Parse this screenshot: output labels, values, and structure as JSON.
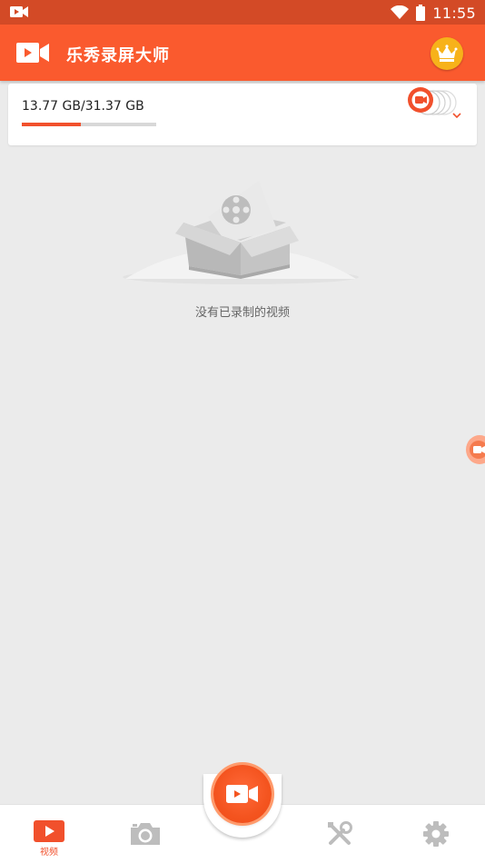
{
  "status_bar": {
    "time": "11:55",
    "icons": [
      "video-record-notification-icon",
      "wifi-icon",
      "battery-icon"
    ]
  },
  "app_bar": {
    "title": "乐秀录屏大师",
    "logo_icon": "video-camera-logo-icon",
    "vip_icon": "crown-icon"
  },
  "storage": {
    "text": "13.77 GB/31.37 GB",
    "used_fraction": 0.439,
    "icons": [
      "record-button-icon",
      "chevron-down-icon"
    ]
  },
  "empty_state": {
    "message": "没有已录制的视频",
    "illustration_icon": "empty-box-film-reel-icon"
  },
  "floating_record": {
    "icon": "floating-record-icon"
  },
  "fab": {
    "icon": "video-camera-record-icon"
  },
  "bottom_nav": {
    "items": [
      {
        "name": "videos",
        "label": "视频",
        "icon": "play-video-icon",
        "active": true
      },
      {
        "name": "screenshots",
        "label": "",
        "icon": "camera-icon",
        "active": false
      },
      {
        "name": "tools",
        "label": "",
        "icon": "tools-icon",
        "active": false
      },
      {
        "name": "settings",
        "label": "",
        "icon": "gear-icon",
        "active": false
      }
    ]
  },
  "colors": {
    "status_bar": "#d34a26",
    "app_bar": "#fa5a2e",
    "accent": "#f1502c",
    "background": "#ebebeb",
    "crown": "#f7b21a"
  }
}
